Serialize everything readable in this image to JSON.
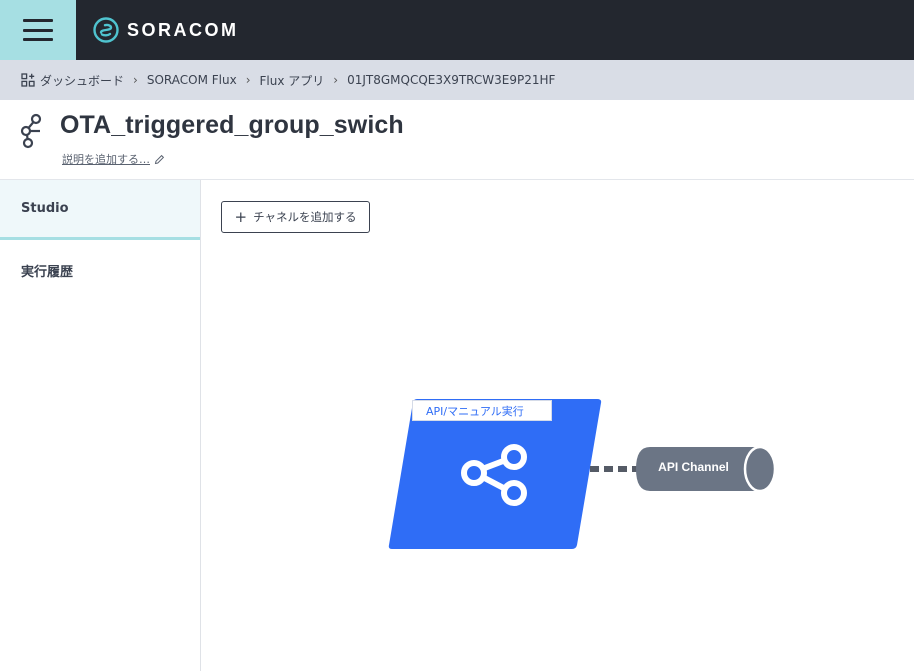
{
  "app": {
    "brand": "SORACOM",
    "accent_color": "#a6dfe3",
    "topbar_color": "#23272f"
  },
  "breadcrumb": {
    "items": [
      "ダッシュボード",
      "SORACOM Flux",
      "Flux アプリ",
      "01JT8GMQCQE3X9TRCW3E9P21HF"
    ]
  },
  "page": {
    "title": "OTA_triggered_group_swich",
    "description_link": "説明を追加する…"
  },
  "sidebar": {
    "items": [
      {
        "label": "Studio",
        "active": true
      },
      {
        "label": "実行履歴",
        "active": false
      }
    ]
  },
  "canvas": {
    "add_channel_label": "チャネルを追加する",
    "trigger_node": {
      "label": "API/マニュアル実行",
      "icon": "share-icon",
      "color": "#2f6df6"
    },
    "channel_node": {
      "label": "API Channel",
      "color": "#6b7585"
    }
  }
}
